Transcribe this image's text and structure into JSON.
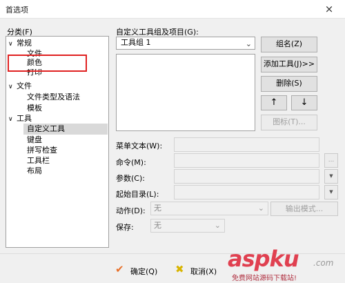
{
  "window": {
    "title": "首选项",
    "close_glyph": "×"
  },
  "category": {
    "label": "分类(F)",
    "items": [
      {
        "text": "常规",
        "expander": "∨",
        "level": 0
      },
      {
        "text": "文件",
        "level": 1
      },
      {
        "text": "颜色",
        "level": 1
      },
      {
        "text": "打印",
        "level": 1
      },
      {
        "text": "文件",
        "expander": "∨",
        "level": 0
      },
      {
        "text": "文件类型及语法",
        "level": 1
      },
      {
        "text": "模板",
        "level": 1
      },
      {
        "text": "工具",
        "expander": "∨",
        "level": 0
      },
      {
        "text": "自定义工具",
        "level": 1,
        "selected": true
      },
      {
        "text": "键盘",
        "level": 1
      },
      {
        "text": "拼写检查",
        "level": 1
      },
      {
        "text": "工具栏",
        "level": 1
      },
      {
        "text": "布局",
        "level": 1
      }
    ]
  },
  "custom": {
    "label": "自定义工具组及项目(G):",
    "group_value": "工具组 1",
    "buttons": {
      "rename": "组名(Z)",
      "add_tool": "添加工具(J)>>",
      "delete": "删除(S)",
      "up": "↑",
      "down": "↓",
      "icon": "图标(T)..."
    }
  },
  "fields": {
    "menu_text": "菜单文本(W):",
    "command": "命令(M):",
    "params": "参数(C):",
    "start_dir": "起始目录(L):",
    "action": "动作(D):",
    "action_value": "无",
    "output_mode": "输出模式...",
    "save": "保存:",
    "save_value": "无",
    "browse_glyph": "...",
    "dropdown_glyph": "▼"
  },
  "footer": {
    "ok": "确定(Q)",
    "cancel": "取消(X)",
    "ok_icon_glyph": "✔",
    "cancel_icon_glyph": "✖"
  },
  "watermark": {
    "brand": "aspku",
    "suffix": ".com",
    "tagline": "免费网站源码下载站!"
  },
  "colors": {
    "highlight": "#e02020",
    "ok_icon": "#e8702a",
    "cancel_icon": "#d8b400",
    "watermark": "#e04050"
  }
}
